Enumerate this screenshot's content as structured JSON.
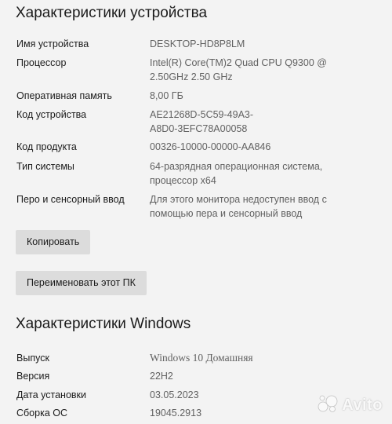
{
  "device_section": {
    "title": "Характеристики устройства",
    "rows": [
      {
        "label": "Имя устройства",
        "lines": [
          "DESKTOP-HD8P8LM"
        ]
      },
      {
        "label": "Процессор",
        "lines": [
          "Intel(R) Core(TM)2 Quad  CPU    Q9300  @",
          "2.50GHz   2.50 GHz"
        ]
      },
      {
        "label": "Оперативная память",
        "lines": [
          "8,00 ГБ"
        ]
      },
      {
        "label": "Код устройства",
        "lines": [
          "AE21268D-5C59-49A3-",
          "A8D0-3EFC78A00058"
        ]
      },
      {
        "label": "Код продукта",
        "lines": [
          "00326-10000-00000-AA846"
        ]
      },
      {
        "label": "Тип системы",
        "lines": [
          "64-разрядная операционная система,",
          "процессор x64"
        ]
      },
      {
        "label": "Перо и сенсорный ввод",
        "lines": [
          "Для этого монитора недоступен ввод с",
          "помощью пера и сенсорный ввод"
        ]
      }
    ]
  },
  "buttons": {
    "copy_label": "Копировать",
    "rename_label": "Переименовать этот ПК"
  },
  "windows_section": {
    "title": "Характеристики Windows",
    "rows": [
      {
        "label": "Выпуск",
        "lines": [
          "Windows 10 Домашняя"
        ]
      },
      {
        "label": "Версия",
        "lines": [
          "22H2"
        ]
      },
      {
        "label": "Дата установки",
        "lines": [
          "03.05.2023"
        ]
      },
      {
        "label": "Сборка ОС",
        "lines": [
          "19045.2913"
        ]
      }
    ]
  },
  "watermark": {
    "text": "Avito",
    "icon": "avito-logo-icon"
  }
}
